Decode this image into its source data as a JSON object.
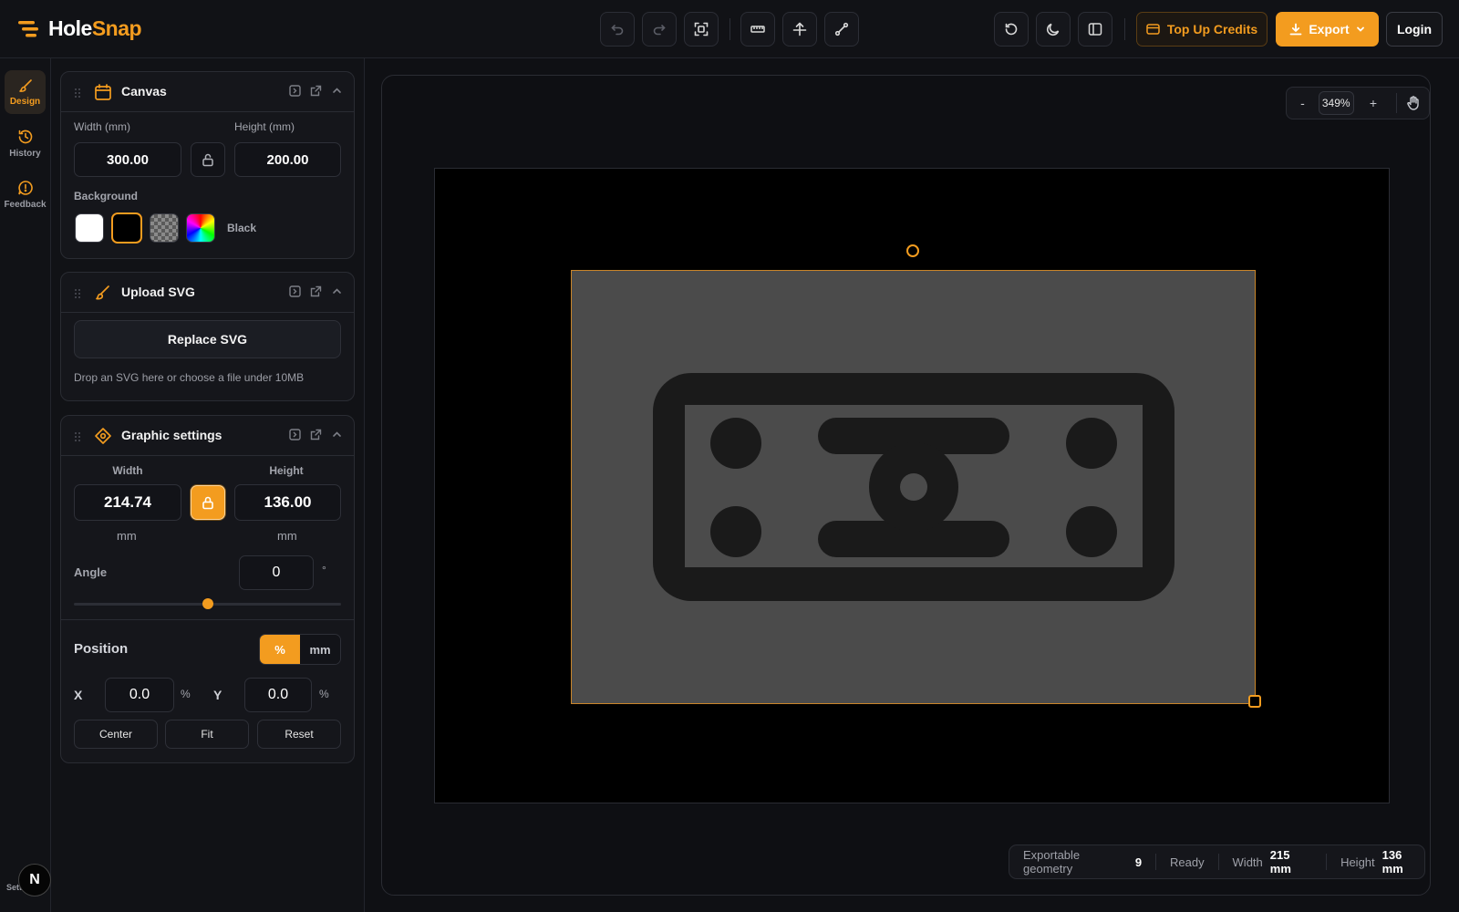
{
  "app": {
    "name_part1": "Hole",
    "name_part2": "Snap"
  },
  "header": {
    "top_up_label": "Top Up Credits",
    "export_label": "Export",
    "login_label": "Login"
  },
  "rail": {
    "items": [
      {
        "label": "Design",
        "icon": "brush-icon"
      },
      {
        "label": "History",
        "icon": "history-icon"
      },
      {
        "label": "Feedback",
        "icon": "feedback-icon"
      }
    ],
    "avatar_letter": "N",
    "bottom_label": "Sett"
  },
  "canvas_panel": {
    "title": "Canvas",
    "width_label": "Width (mm)",
    "height_label": "Height (mm)",
    "width_value": "300.00",
    "height_value": "200.00",
    "background_label": "Background",
    "background_selected": "Black"
  },
  "upload_panel": {
    "title": "Upload SVG",
    "replace_label": "Replace SVG",
    "hint": "Drop an SVG here or choose a file under 10MB"
  },
  "graphic_panel": {
    "title": "Graphic settings",
    "width_label": "Width",
    "height_label": "Height",
    "width_value": "214.74",
    "height_value": "136.00",
    "unit": "mm",
    "angle_label": "Angle",
    "angle_value": "0",
    "angle_unit": "°",
    "position_label": "Position",
    "unit_percent": "%",
    "unit_mm": "mm",
    "x_label": "X",
    "y_label": "Y",
    "x_value": "0.0",
    "y_value": "0.0",
    "center_label": "Center",
    "fit_label": "Fit",
    "reset_label": "Reset"
  },
  "zoom": {
    "minus": "-",
    "value": "349%",
    "plus": "+"
  },
  "status": {
    "geometry_label": "Exportable geometry",
    "geometry_value": "9",
    "state": "Ready",
    "width_label": "Width",
    "width_value": "215 mm",
    "height_label": "Height",
    "height_value": "136 mm"
  },
  "colors": {
    "accent": "#f39c1f",
    "background": "#0f1014",
    "graphic_fill": "#4b4b4b",
    "shape_fill": "#1a1a1a"
  }
}
